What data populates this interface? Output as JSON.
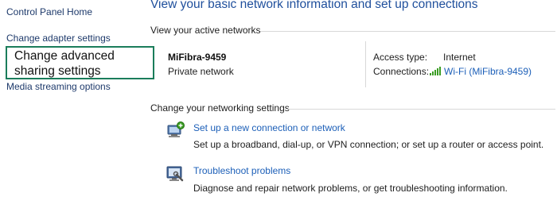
{
  "sidebar": {
    "items": [
      {
        "label": "Control Panel Home"
      },
      {
        "label": "Change adapter settings"
      },
      {
        "label": "Change advanced sharing settings"
      },
      {
        "label": "Media streaming options"
      }
    ]
  },
  "main": {
    "title": "View your basic network information and set up connections",
    "active_networks": {
      "header": "View your active networks",
      "network_name": "MiFibra-9459",
      "network_type": "Private network",
      "access_type_label": "Access type:",
      "access_type_value": "Internet",
      "connections_label": "Connections:",
      "connection_link": "Wi-Fi (MiFibra-9459)"
    },
    "networking_settings": {
      "header": "Change your networking settings",
      "tasks": [
        {
          "title": "Set up a new connection or network",
          "description": "Set up a broadband, dial-up, or VPN connection; or set up a router or access point.",
          "icon": "new-connection-icon"
        },
        {
          "title": "Troubleshoot problems",
          "description": "Diagnose and repair network problems, or get troubleshooting information.",
          "icon": "troubleshoot-icon"
        }
      ]
    }
  },
  "colors": {
    "link": "#1c5fb8",
    "title": "#1f4f9c",
    "highlight_border": "#1b7d5b",
    "wifi_signal": "#3a9d23"
  }
}
